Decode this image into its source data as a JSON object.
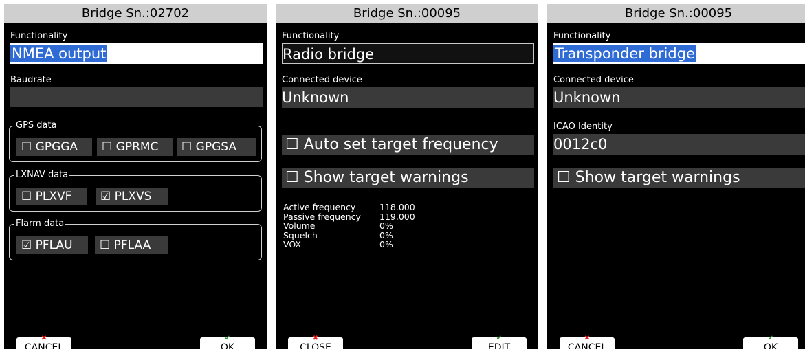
{
  "panel1": {
    "title": "Bridge Sn.:02702",
    "functionality_label": "Functionality",
    "functionality_value": "NMEA output",
    "baudrate_label": "Baudrate",
    "baudrate_value": "",
    "gps_group": "GPS data",
    "gps": [
      {
        "box": "☐",
        "label": "GPGGA"
      },
      {
        "box": "☐",
        "label": "GPRMC"
      },
      {
        "box": "☐",
        "label": "GPGSA"
      }
    ],
    "lxnav_group": "LXNAV data",
    "lxnav": [
      {
        "box": "☐",
        "label": "PLXVF"
      },
      {
        "box": "☑",
        "label": "PLXVS"
      }
    ],
    "flarm_group": "Flarm data",
    "flarm": [
      {
        "box": "☑",
        "label": "PFLAU"
      },
      {
        "box": "☐",
        "label": "PFLAA"
      }
    ],
    "left_button": "CANCEL",
    "right_button": "OK"
  },
  "panel2": {
    "title": "Bridge Sn.:00095",
    "functionality_label": "Functionality",
    "functionality_value": "Radio bridge",
    "device_label": "Connected device",
    "device_value": "Unknown",
    "auto_set": {
      "box": "☐",
      "label": "Auto set target frequency"
    },
    "show_warnings": {
      "box": "☐",
      "label": "Show target warnings"
    },
    "info": [
      {
        "key": "Active frequency",
        "value": "118.000"
      },
      {
        "key": "Passive frequency",
        "value": "119.000"
      },
      {
        "key": "Volume",
        "value": "0%"
      },
      {
        "key": "Squelch",
        "value": "0%"
      },
      {
        "key": "VOX",
        "value": "0%"
      }
    ],
    "left_button": "CLOSE",
    "right_button": "EDIT"
  },
  "panel3": {
    "title": "Bridge Sn.:00095",
    "functionality_label": "Functionality",
    "functionality_value": "Transponder bridge",
    "device_label": "Connected device",
    "device_value": "Unknown",
    "icao_label": "ICAO Identity",
    "icao_value": "0012c0",
    "show_warnings": {
      "box": "☐",
      "label": "Show target warnings"
    },
    "left_button": "CANCEL",
    "right_button": "OK"
  },
  "colors": {
    "selection": "#2f6bd4",
    "cancel_mark": "#e02020",
    "ok_mark": "#2a9a2a"
  }
}
